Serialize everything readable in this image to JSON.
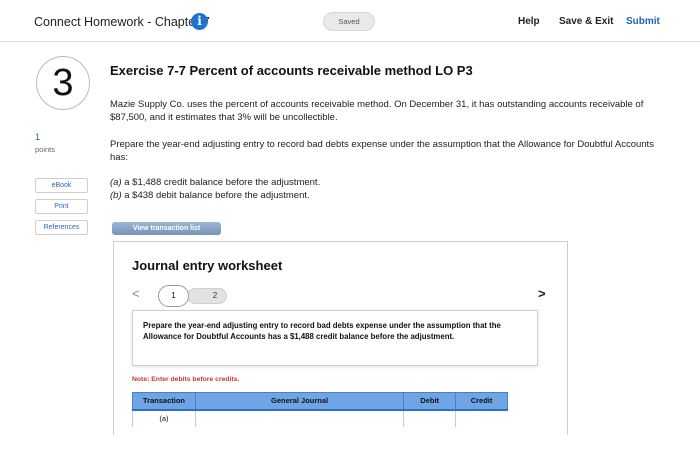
{
  "header": {
    "app_title": "Connect Homework - Chapter 7",
    "info_icon": "info-icon",
    "saved_label": "Saved",
    "help_label": "Help",
    "save_exit_label": "Save & Exit",
    "submit_label": "Submit"
  },
  "question": {
    "number": "3",
    "points_value": "1",
    "points_label": "points"
  },
  "sidebar": {
    "ebook_label": "eBook",
    "print_label": "Print",
    "references_label": "References"
  },
  "exercise": {
    "title": "Exercise 7-7 Percent of accounts receivable method LO P3",
    "paragraph1": "Mazie Supply Co. uses the percent of accounts receivable method. On December 31, it has outstanding accounts receivable of $87,500, and it estimates that 3% will be uncollectible.",
    "paragraph2": "Prepare the year-end adjusting entry to record bad debts expense under the assumption that the Allowance for Doubtful Accounts has:",
    "option_a_prefix": "(a)",
    "option_a_text": " a $1,488 credit balance before the adjustment.",
    "option_b_prefix": "(b)",
    "option_b_text": " a $438 debit balance before the adjustment.",
    "view_transaction_label": "View transaction list"
  },
  "worksheet": {
    "title": "Journal entry worksheet",
    "nav_prev": "<",
    "nav_next": ">",
    "page1": "1",
    "page2": "2",
    "instruction": "Prepare the year-end adjusting entry to record bad debts expense under the assumption that the Allowance for Doubtful Accounts has a $1,488 credit balance before the adjustment.",
    "note": "Note: Enter debits before credits.",
    "columns": [
      "Transaction",
      "General Journal",
      "Debit",
      "Credit"
    ],
    "rows": [
      {
        "transaction": "(a)",
        "general_journal": "",
        "debit": "",
        "credit": ""
      }
    ]
  },
  "colors": {
    "accent_blue": "#1e73d2",
    "table_header": "#6fa4e6",
    "note_red": "#c0392b"
  }
}
